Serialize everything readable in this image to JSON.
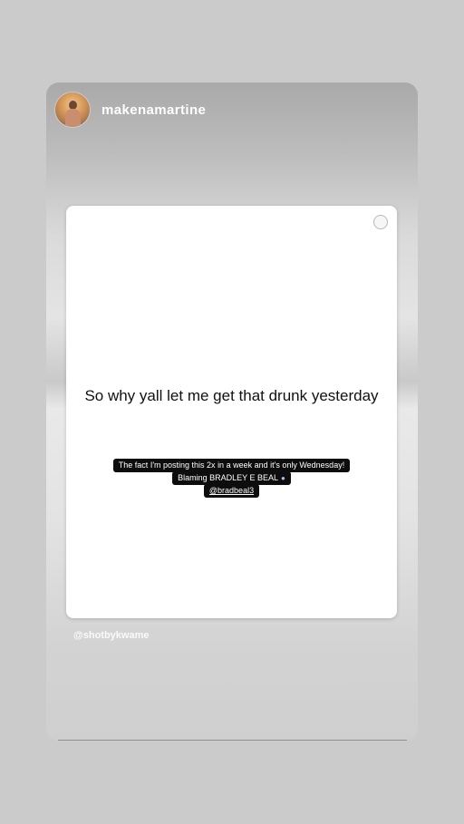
{
  "story": {
    "username": "makenamartine",
    "card": {
      "text": "So why yall let me get that drunk yesterday",
      "caption_lines": [
        "The fact I'm posting this 2x in a week and it's only Wednesday!",
        "Blaming BRADLEY E BEAL",
        "@bradbeal3"
      ]
    },
    "credit": "@shotbykwame"
  },
  "icons": {
    "avatar": "profile-avatar",
    "emoji": "speaking-head-icon",
    "card_corner": "circle-icon"
  }
}
